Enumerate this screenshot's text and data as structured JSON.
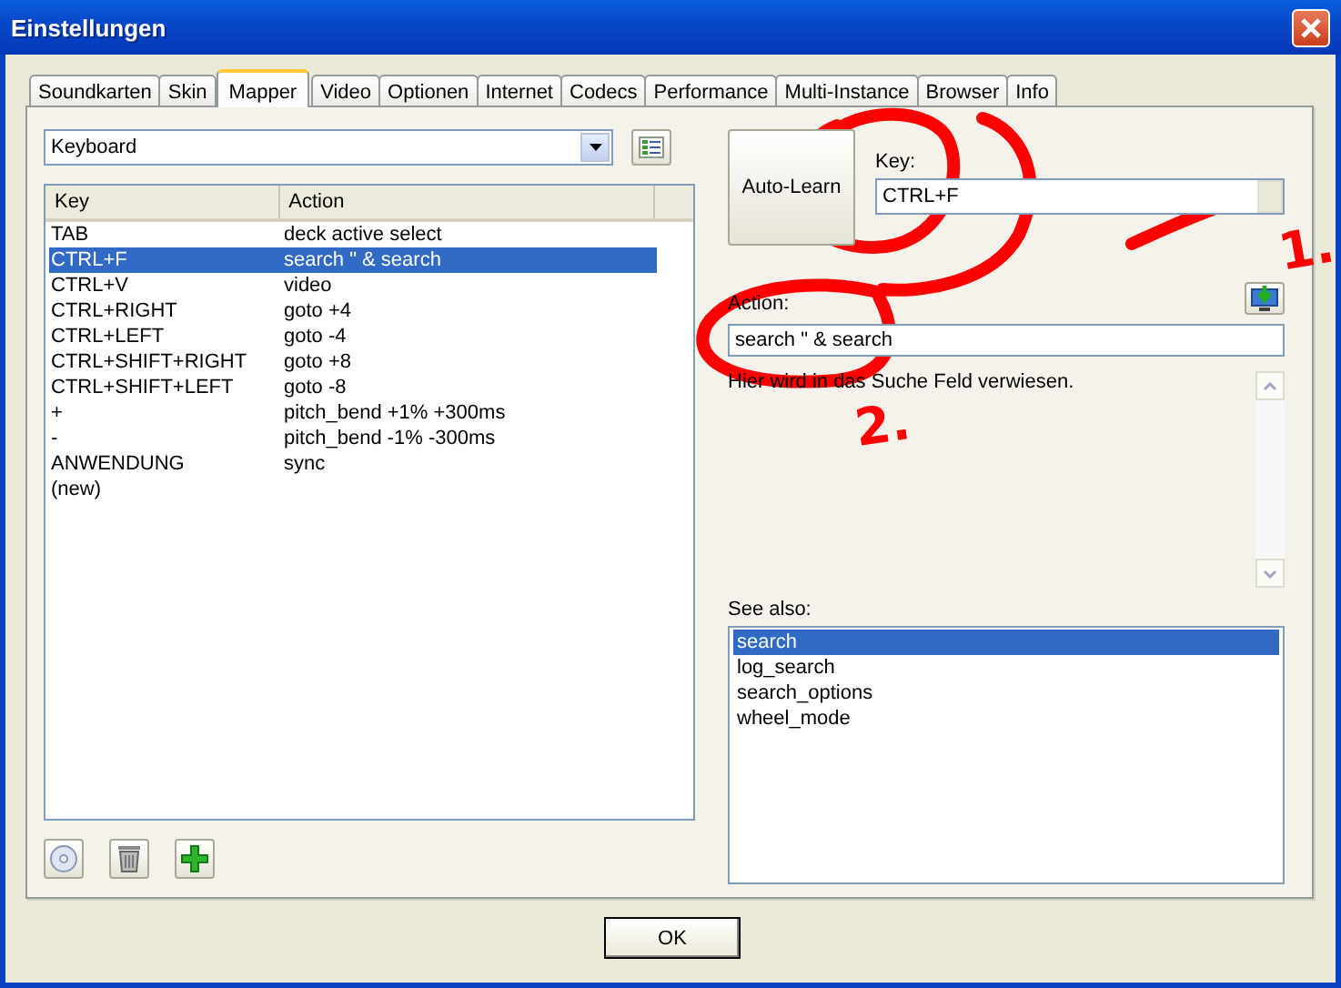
{
  "window": {
    "title": "Einstellungen"
  },
  "tabs": [
    {
      "label": "Soundkarten",
      "selected": false
    },
    {
      "label": "Skin",
      "selected": false
    },
    {
      "label": "Mapper",
      "selected": true
    },
    {
      "label": "Video",
      "selected": false
    },
    {
      "label": "Optionen",
      "selected": false
    },
    {
      "label": "Internet",
      "selected": false
    },
    {
      "label": "Codecs",
      "selected": false
    },
    {
      "label": "Performance",
      "selected": false
    },
    {
      "label": "Multi-Instance",
      "selected": false
    },
    {
      "label": "Browser",
      "selected": false
    },
    {
      "label": "Info",
      "selected": false
    }
  ],
  "device": {
    "value": "Keyboard"
  },
  "table": {
    "columns": [
      "Key",
      "Action"
    ],
    "rows": [
      {
        "key": "TAB",
        "action": "deck active select",
        "selected": false
      },
      {
        "key": "CTRL+F",
        "action": "search \" & search",
        "selected": true
      },
      {
        "key": "CTRL+V",
        "action": "video",
        "selected": false
      },
      {
        "key": "CTRL+RIGHT",
        "action": "goto +4",
        "selected": false
      },
      {
        "key": "CTRL+LEFT",
        "action": "goto -4",
        "selected": false
      },
      {
        "key": "CTRL+SHIFT+RIGHT",
        "action": "goto +8",
        "selected": false
      },
      {
        "key": "CTRL+SHIFT+LEFT",
        "action": "goto -8",
        "selected": false
      },
      {
        "key": "+",
        "action": "pitch_bend +1% +300ms",
        "selected": false
      },
      {
        "key": "-",
        "action": "pitch_bend -1% -300ms",
        "selected": false
      },
      {
        "key": "ANWENDUNG",
        "action": "sync",
        "selected": false
      },
      {
        "key": "(new)",
        "selected": false
      }
    ]
  },
  "auto_learn_button": "Auto-Learn",
  "key_field": {
    "label": "Key:",
    "value": "CTRL+F"
  },
  "action_field": {
    "label": "Action:",
    "value": "search \" & search"
  },
  "description": "Hier wird in das Suche Feld verwiesen.",
  "see_also": {
    "label": "See also:",
    "items": [
      {
        "label": "search",
        "selected": true
      },
      {
        "label": "log_search",
        "selected": false
      },
      {
        "label": "search_options",
        "selected": false
      },
      {
        "label": "wheel_mode",
        "selected": false
      }
    ]
  },
  "buttons": [
    "OK"
  ],
  "annotations": [
    {
      "text": "1."
    },
    {
      "text": "2."
    }
  ]
}
